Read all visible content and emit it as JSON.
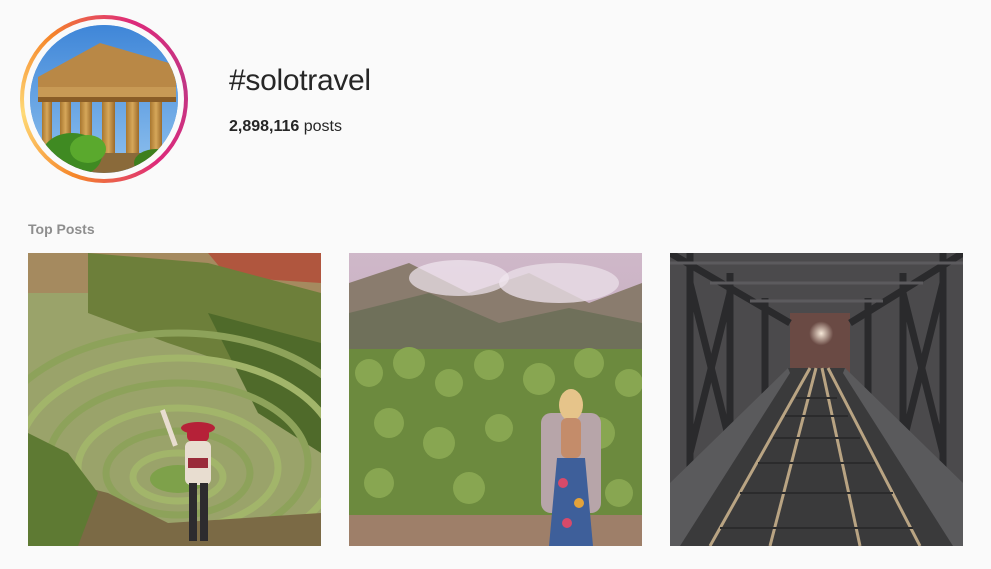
{
  "hashtag": {
    "title": "#solotravel",
    "post_count": "2,898,116",
    "post_count_suffix": " posts"
  },
  "top_posts": {
    "heading": "Top Posts",
    "items": [
      {
        "subject": "terraces-photo"
      },
      {
        "subject": "hedge-wall-photo"
      },
      {
        "subject": "railway-bridge-photo"
      }
    ]
  },
  "colors": {
    "background": "#fafafa",
    "text": "#262626",
    "muted": "#8e8e8e",
    "story_ring_start": "#f58529",
    "story_ring_end": "#c13584"
  }
}
